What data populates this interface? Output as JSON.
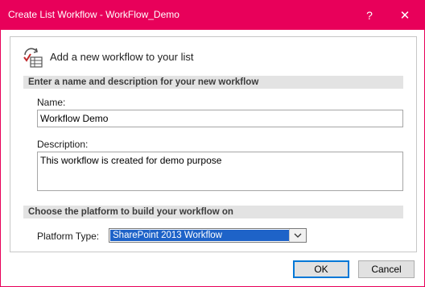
{
  "window": {
    "title": "Create List Workflow - WorkFlow_Demo",
    "help_glyph": "?",
    "close_glyph": "✕",
    "accent_color": "#e8005a"
  },
  "header": {
    "icon": "workflow-list-icon",
    "text": "Add a new workflow to your list"
  },
  "name_section": {
    "heading": "Enter a name and description for your new workflow",
    "name_label": "Name:",
    "name_value": "Workflow Demo",
    "description_label": "Description:",
    "description_value": "This workflow is created for demo purpose"
  },
  "platform_section": {
    "heading": "Choose the platform to build your workflow on",
    "platform_label": "Platform Type:",
    "platform_selected": "SharePoint 2013 Workflow"
  },
  "buttons": {
    "ok": "OK",
    "cancel": "Cancel"
  }
}
